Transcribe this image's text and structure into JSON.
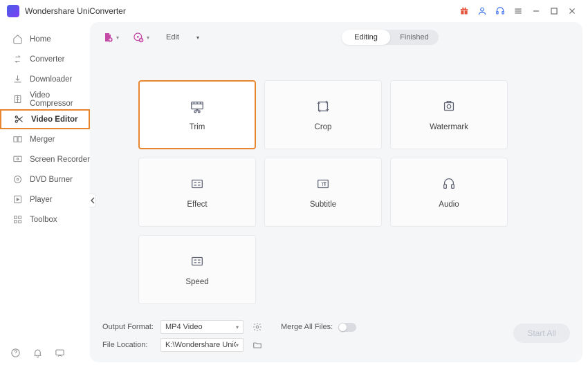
{
  "app": {
    "title": "Wondershare UniConverter"
  },
  "sidebar": {
    "items": [
      {
        "label": "Home"
      },
      {
        "label": "Converter"
      },
      {
        "label": "Downloader"
      },
      {
        "label": "Video Compressor"
      },
      {
        "label": "Video Editor"
      },
      {
        "label": "Merger"
      },
      {
        "label": "Screen Recorder"
      },
      {
        "label": "DVD Burner"
      },
      {
        "label": "Player"
      },
      {
        "label": "Toolbox"
      }
    ]
  },
  "toolbar": {
    "edit_label": "Edit",
    "editing_tab": "Editing",
    "finished_tab": "Finished"
  },
  "cards": {
    "trim": "Trim",
    "crop": "Crop",
    "watermark": "Watermark",
    "effect": "Effect",
    "subtitle": "Subtitle",
    "audio": "Audio",
    "speed": "Speed"
  },
  "footer": {
    "output_format_label": "Output Format:",
    "output_format_value": "MP4 Video",
    "file_location_label": "File Location:",
    "file_location_value": "K:\\Wondershare UniConverter",
    "merge_label": "Merge All Files:",
    "start_label": "Start All"
  }
}
